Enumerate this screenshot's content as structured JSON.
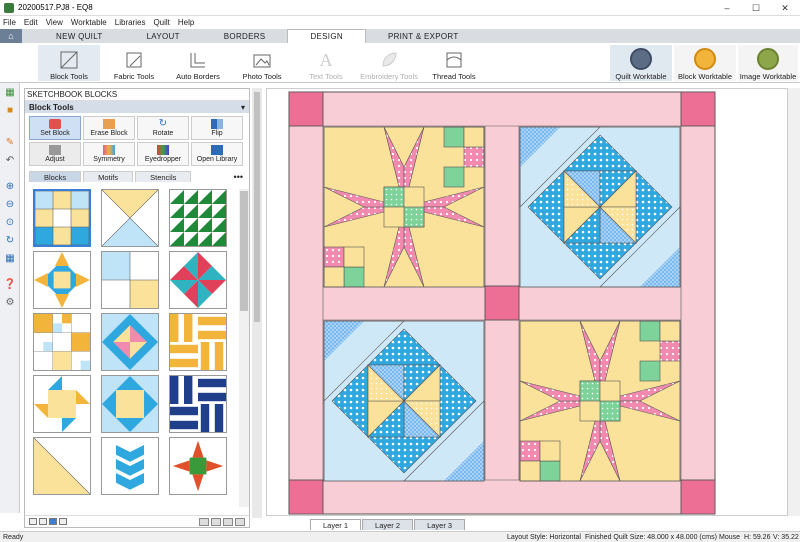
{
  "window": {
    "title": "20200517.PJ8 - EQ8"
  },
  "menu": [
    "File",
    "Edit",
    "View",
    "Worktable",
    "Libraries",
    "Quilt",
    "Help"
  ],
  "tabs": [
    {
      "label": "NEW QUILT"
    },
    {
      "label": "LAYOUT"
    },
    {
      "label": "BORDERS"
    },
    {
      "label": "DESIGN"
    },
    {
      "label": "PRINT & EXPORT"
    }
  ],
  "ribbon": {
    "tools": [
      {
        "label": "Block Tools"
      },
      {
        "label": "Fabric Tools"
      },
      {
        "label": "Auto Borders"
      },
      {
        "label": "Photo Tools"
      },
      {
        "label": "Text Tools"
      },
      {
        "label": "Embroidery Tools"
      },
      {
        "label": "Thread Tools"
      }
    ],
    "worktables": [
      {
        "label": "Quilt Worktable"
      },
      {
        "label": "Block Worktable"
      },
      {
        "label": "Image Worktable"
      }
    ]
  },
  "panel": {
    "title": "SKETCHBOOK BLOCKS",
    "subtitle": "Block Tools",
    "tools": [
      {
        "label": "Set Block"
      },
      {
        "label": "Erase Block"
      },
      {
        "label": "Rotate"
      },
      {
        "label": "Flip"
      },
      {
        "label": "Adjust"
      },
      {
        "label": "Symmetry"
      },
      {
        "label": "Eyedropper"
      },
      {
        "label": "Open Library"
      }
    ],
    "subtabs": [
      {
        "label": "Blocks"
      },
      {
        "label": "Motifs"
      },
      {
        "label": "Stencils"
      }
    ],
    "more": "•••"
  },
  "layers": [
    {
      "label": "Layer 1"
    },
    {
      "label": "Layer 2"
    },
    {
      "label": "Layer 3"
    }
  ],
  "status": {
    "ready": "Ready",
    "layout_style": "Layout Style: Horizontal",
    "finished_size": "Finished Quilt Size: 48.000 x 48.000 (cms)",
    "mouse": "Mouse",
    "h": "H: 59.26",
    "v": "V: 35.22"
  },
  "colors": {
    "sashing_pink": "#f9cdd6",
    "cornerstone": "#ee6f95",
    "star_pink": "#f28ab0",
    "yellow": "#fbe29a",
    "blue": "#2fa8e0",
    "light_blue": "#bfe3f7",
    "green": "#7ed39a",
    "accent_blue": "#3a7fd5"
  }
}
